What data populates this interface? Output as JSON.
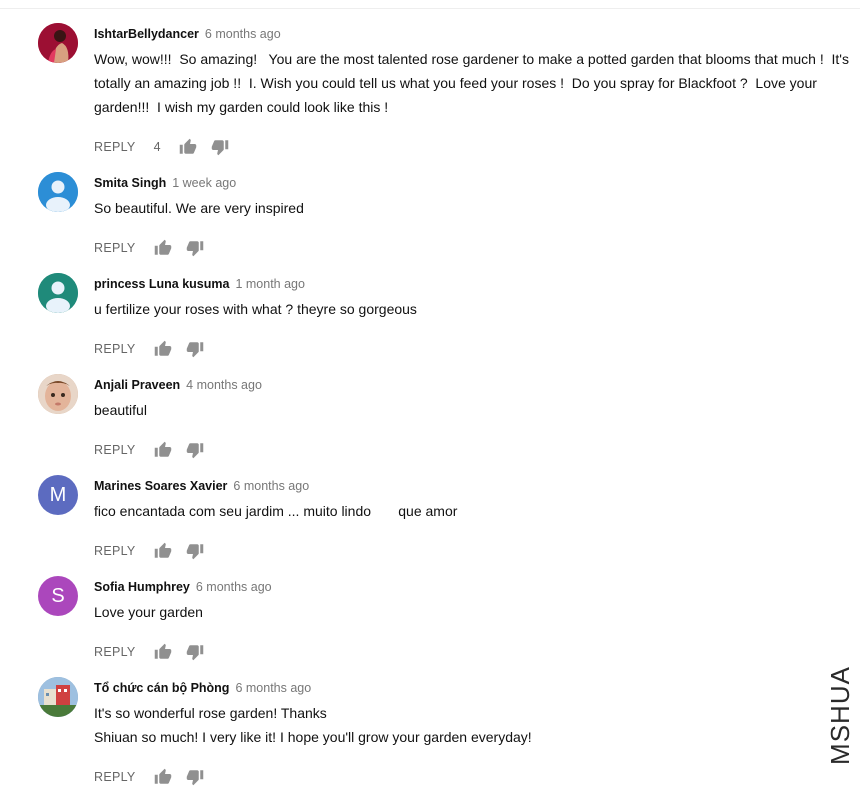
{
  "comments": [
    {
      "author": "IshtarBellydancer",
      "time": "6 months ago",
      "lines": [
        "Wow, wow!!!  So amazing!   You are the most talented rose gardener to make a potted garden that blooms that much !  It's totally an amazing job !!  I. Wish you could tell us what you feed your roses !  Do you spray for Blackfoot ?  Love your garden!!!  I wish my garden could look like this !"
      ],
      "reply_label": "REPLY",
      "likes": "4",
      "avatar": {
        "kind": "photo",
        "icon": "woman-photo",
        "color": "#b3123a"
      }
    },
    {
      "author": "Smita Singh",
      "time": "1 week ago",
      "lines": [
        "So beautiful. We are very inspired"
      ],
      "reply_label": "REPLY",
      "avatar": {
        "kind": "person",
        "icon": "default-person",
        "color": "#2c8ed6"
      }
    },
    {
      "author": "princess Luna kusuma",
      "time": "1 month ago",
      "lines": [
        "u fertilize your roses with what ? theyre so gorgeous"
      ],
      "reply_label": "REPLY",
      "avatar": {
        "kind": "person",
        "icon": "default-person",
        "color": "#1f8a7a"
      }
    },
    {
      "author": "Anjali Praveen",
      "time": "4 months ago",
      "lines": [
        "beautiful"
      ],
      "reply_label": "REPLY",
      "avatar": {
        "kind": "photo",
        "icon": "child-photo",
        "color": "#c79a7a"
      }
    },
    {
      "author": "Marines Soares Xavier",
      "time": "6 months ago",
      "lines": [
        "fico encantada com seu jardim ... muito lindo       que amor"
      ],
      "reply_label": "REPLY",
      "avatar": {
        "kind": "letter",
        "letter": "M",
        "color": "#5c6bc0"
      }
    },
    {
      "author": "Sofia Humphrey",
      "time": "6 months ago",
      "lines": [
        "Love your garden"
      ],
      "reply_label": "REPLY",
      "avatar": {
        "kind": "letter",
        "letter": "S",
        "color": "#ab47bc"
      }
    },
    {
      "author": "Tổ chức cán bộ Phòng",
      "time": "6 months ago",
      "lines": [
        "It's so wonderful rose garden! Thanks",
        "Shiuan so much! I very like it! I hope you'll grow your garden everyday!"
      ],
      "reply_label": "REPLY",
      "avatar": {
        "kind": "photo",
        "icon": "building-photo",
        "color": "#6a8fb0"
      }
    }
  ],
  "watermark": "MSHUA",
  "icons": {
    "like": "thumbs-up-icon",
    "dislike": "thumbs-down-icon"
  }
}
